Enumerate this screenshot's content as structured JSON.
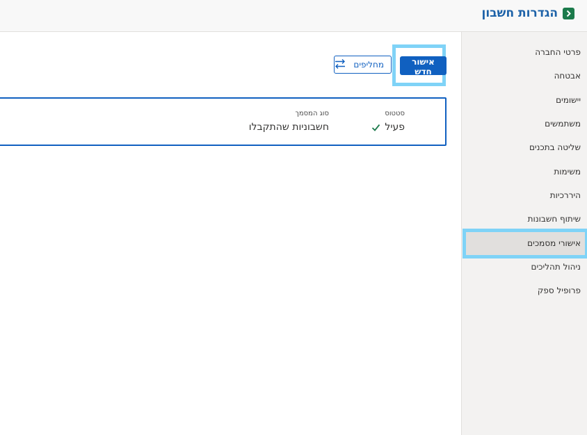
{
  "header": {
    "title": "הגדרות חשבון",
    "accent": "#1d62a8",
    "back_icon_color": "#1b7a4b"
  },
  "sidebar": {
    "items": [
      {
        "label": "פרטי החברה"
      },
      {
        "label": "אבטחה"
      },
      {
        "label": "יישומים"
      },
      {
        "label": "משתמשים"
      },
      {
        "label": "שליטה בתכנים"
      },
      {
        "label": "משימות"
      },
      {
        "label": "היררכיות"
      },
      {
        "label": "שיתוף חשבונות"
      },
      {
        "label": "אישורי מסמכים",
        "active": true
      },
      {
        "label": "ניהול תהליכים"
      },
      {
        "label": "פרופיל ספק"
      }
    ]
  },
  "toolbar": {
    "new_approval_label": "אישור חדש",
    "switch_label": "מחליפים",
    "primary_color": "#1060c0"
  },
  "approval_card": {
    "status_label": "סטטוס",
    "status_value": "פעיל",
    "doc_type_label": "סוג המסמך",
    "doc_type_value": "חשבוניות שהתקבלו"
  }
}
